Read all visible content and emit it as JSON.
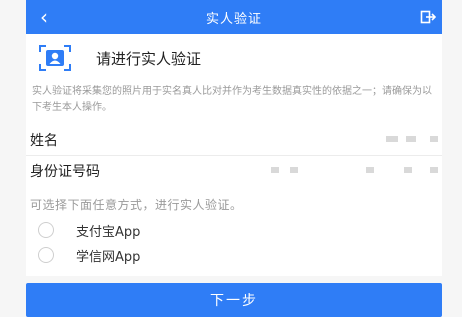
{
  "header": {
    "title": "实人验证",
    "back_icon": "chevron-left-icon",
    "exit_icon": "logout-icon"
  },
  "intro": {
    "icon": "id-card-icon",
    "heading": "请进行实人验证",
    "description": "实人验证将采集您的照片用于实名真人比对并作为考生数据真实性的依据之一；请确保为以下考生本人操作。"
  },
  "fields": {
    "name_label": "姓名",
    "id_label": "身份证号码"
  },
  "method": {
    "prompt": "可选择下面任意方式，进行实人验证。",
    "options": [
      {
        "label": "支付宝App"
      },
      {
        "label": "学信网App"
      }
    ]
  },
  "next_button": {
    "label": "下一步"
  },
  "colors": {
    "accent": "#2f7df6",
    "background": "#f6f6f6"
  }
}
